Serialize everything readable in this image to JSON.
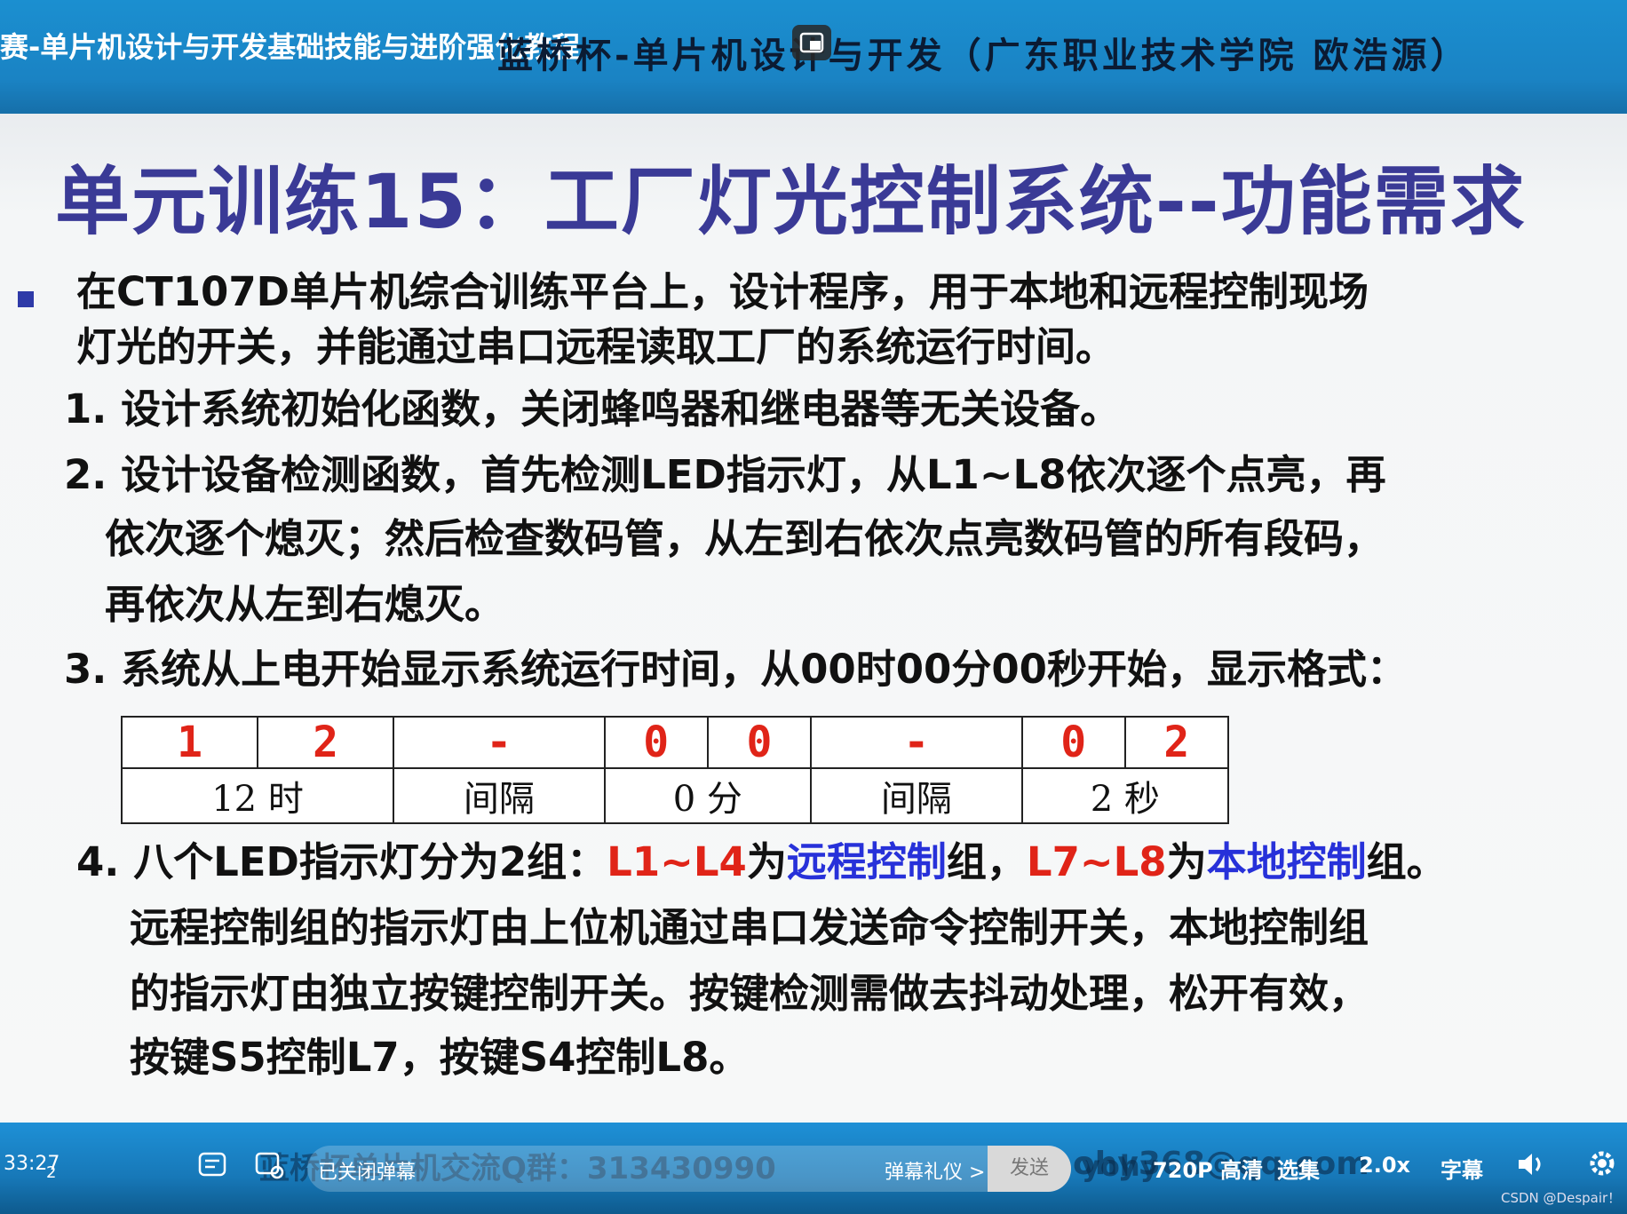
{
  "video": {
    "course_title": "赛-单片机设计与开发基础技能与进阶强化教程",
    "header_banner": "蓝桥杯-单片机设计与开发（广东职业技术学院 欧浩源）"
  },
  "slide": {
    "title": "单元训练15：工厂灯光控制系统--功能需求",
    "intro_line1": "在CT107D单片机综合训练平台上，设计程序，用于本地和远程控制现场",
    "intro_line2": "灯光的开关，并能通过串口远程读取工厂的系统运行时间。",
    "item1": "1. 设计系统初始化函数，关闭蜂鸣器和继电器等无关设备。",
    "item2_line1": "2. 设计设备检测函数，首先检测LED指示灯，从L1~L8依次逐个点亮，再",
    "item2_line2": "依次逐个熄灭；然后检查数码管，从左到右依次点亮数码管的所有段码，",
    "item2_line3": "再依次从左到右熄灭。",
    "item3": "3. 系统从上电开始显示系统运行时间，从00时00分00秒开始，显示格式：",
    "display": {
      "digits": [
        "1",
        "2",
        "-",
        "0",
        "0",
        "-",
        "0",
        "2"
      ],
      "labels": [
        "12 时",
        "间隔",
        "0 分",
        "间隔",
        "2 秒"
      ]
    },
    "item4": {
      "p1": "4. 八个LED指示灯分为2组：",
      "p2": "L1~L4",
      "p3": "为",
      "p4": "远程控制",
      "p5": "组，",
      "p6": "L7~L8",
      "p7": "为",
      "p8": "本地控制",
      "p9": "组。",
      "line2": "远程控制组的指示灯由上位机通过串口发送命令控制开关，本地控制组",
      "line3": "的指示灯由独立按键控制开关。按键检测需做去抖动处理，松开有效，",
      "line4": "按键S5控制L7，按键S4控制L8。"
    }
  },
  "player": {
    "time": "33:27",
    "page_small": "2",
    "danmaku_closed": "已关闭弹幕",
    "danmaku_etiquette": "弹幕礼仪 >",
    "send": "发送",
    "qq_group": "蓝桥杯单片机交流Q群：313430990",
    "overlay_tail": "yohy",
    "email_fragment": "ohy368@qq.com",
    "quality": "720P 高清",
    "episodes": "选集",
    "speed": "2.0x",
    "subtitles": "字幕",
    "watermark": "CSDN @Despair！"
  },
  "colors": {
    "title": "#3a3a96",
    "highlight_red": "#e02418",
    "highlight_blue": "#2731d9",
    "bar": "#1a83c4"
  }
}
